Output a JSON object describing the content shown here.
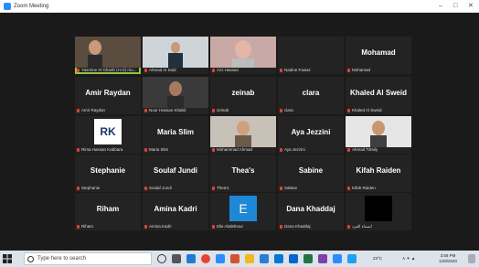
{
  "window": {
    "title": "Zoom Meeting"
  },
  "tiles": [
    {
      "name": "",
      "label": "Yasmine Al Gharib (H.O) mu...",
      "kind": "photo-woman"
    },
    {
      "name": "",
      "label": "Ahmad Al Said",
      "kind": "photo-man-suit"
    },
    {
      "name": "",
      "label": "Azz Hassan",
      "kind": "photo-man-glasses"
    },
    {
      "name": "",
      "label": "Nadine Fawaz",
      "kind": "blank"
    },
    {
      "name": "Mohamad",
      "label": "Mohamad",
      "kind": "name"
    },
    {
      "name": "Amir Raydan",
      "label": "Amir Raydan",
      "kind": "name"
    },
    {
      "name": "",
      "label": "Nour Hassan Khalid",
      "kind": "photo-man-dark"
    },
    {
      "name": "zeinab",
      "label": "zeinab",
      "kind": "name"
    },
    {
      "name": "clara",
      "label": "clara",
      "kind": "name"
    },
    {
      "name": "Khaled Al Sweid",
      "label": "Khaled Al Sweid",
      "kind": "name"
    },
    {
      "name": "",
      "label": "Rima Hassan Kabbara",
      "kind": "logo-rk"
    },
    {
      "name": "Maria Slim",
      "label": "Maria Slim",
      "kind": "name"
    },
    {
      "name": "",
      "label": "Mohammad Ahmad",
      "kind": "photo-man-beard"
    },
    {
      "name": "Aya Jezzini",
      "label": "Aya Jezzini",
      "kind": "name"
    },
    {
      "name": "",
      "label": "Ahmad Tofaily",
      "kind": "photo-man-light"
    },
    {
      "name": "Stephanie",
      "label": "Stephanie",
      "kind": "name"
    },
    {
      "name": "Soulaf Jundi",
      "label": "Soulaf Jundi",
      "kind": "name"
    },
    {
      "name": "Thea's",
      "label": "Thea's",
      "kind": "name"
    },
    {
      "name": "Sabine",
      "label": "Sabine",
      "kind": "name"
    },
    {
      "name": "Kifah Raiden",
      "label": "Kifah Raiden",
      "kind": "name"
    },
    {
      "name": "Riham",
      "label": "Riham",
      "kind": "name"
    },
    {
      "name": "Amina Kadri",
      "label": "Amina Kadri",
      "kind": "name"
    },
    {
      "name": "",
      "label": "Elie Abdelnour",
      "kind": "avatar-e"
    },
    {
      "name": "Dana Khaddaj",
      "label": "Dana Khaddaj",
      "kind": "name"
    },
    {
      "name": "",
      "label": "اسماء الفرد",
      "kind": "photo-black"
    }
  ],
  "avatar_letter": "E",
  "logo_letters": "RK",
  "taskbar": {
    "search_placeholder": "Type here to search",
    "weather": "23°C",
    "time": "3:58 PM",
    "date": "12/8/2020"
  },
  "colors": {
    "active_border": "#8fc43c",
    "mic_muted": "#e0403a",
    "avatar_e": "#1e88d6",
    "zoom_blue": "#2d8cff"
  }
}
